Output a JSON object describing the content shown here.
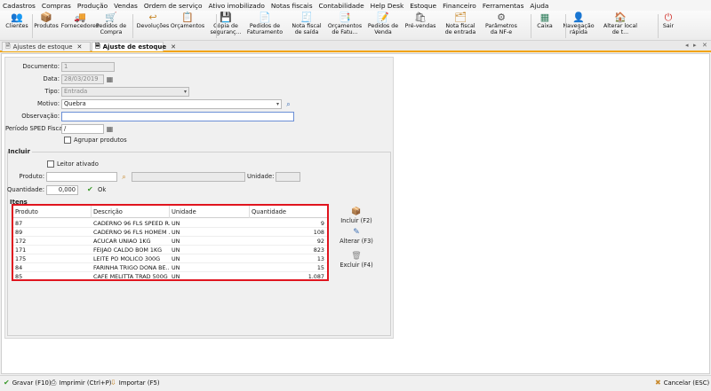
{
  "menu": [
    "Cadastros",
    "Compras",
    "Produção",
    "Vendas",
    "Ordem de serviço",
    "Ativo imobilizado",
    "Notas fiscais",
    "Contabilidade",
    "Help Desk",
    "Estoque",
    "Financeiro",
    "Ferramentas",
    "Ajuda"
  ],
  "toolbar": [
    {
      "name": "clientes",
      "label": [
        "Clientes"
      ],
      "icon": "👥",
      "color": "#3b6db3"
    },
    {
      "name": "produtos",
      "label": [
        "Produtos"
      ],
      "icon": "📦",
      "color": "#c8892c"
    },
    {
      "name": "fornecedores",
      "label": [
        "Fornecedores"
      ],
      "icon": "🚚",
      "color": "#3b6db3"
    },
    {
      "name": "pedidos-compra",
      "label": [
        "Pedidos de",
        "Compra"
      ],
      "icon": "🛒",
      "color": "#555"
    },
    {
      "name": "devolucoes",
      "label": [
        "Devoluções"
      ],
      "icon": "↩",
      "color": "#c8892c"
    },
    {
      "name": "orcamentos",
      "label": [
        "Orçamentos"
      ],
      "icon": "📋",
      "color": "#3b6db3"
    },
    {
      "name": "copia-seguranca",
      "label": [
        "Cópia de",
        "seguranç..."
      ],
      "icon": "💾",
      "color": "#555"
    },
    {
      "name": "pedidos-faturamento",
      "label": [
        "Pedidos de",
        "Faturamento"
      ],
      "icon": "📄",
      "color": "#3b6db3"
    },
    {
      "name": "nota-fiscal-saida",
      "label": [
        "Nota fiscal",
        "de saída"
      ],
      "icon": "🧾",
      "color": "#3b6db3"
    },
    {
      "name": "orcamentos-fatu",
      "label": [
        "Orçamentos",
        "de Fatu..."
      ],
      "icon": "📑",
      "color": "#3b6db3"
    },
    {
      "name": "pedidos-venda",
      "label": [
        "Pedidos de",
        "Venda"
      ],
      "icon": "📝",
      "color": "#c8892c"
    },
    {
      "name": "pre-vendas",
      "label": [
        "Pré-vendas"
      ],
      "icon": "🛍",
      "color": "#555"
    },
    {
      "name": "nota-fiscal-entrada",
      "label": [
        "Nota fiscal",
        "de entrada"
      ],
      "icon": "🗂",
      "color": "#c8892c"
    },
    {
      "name": "parametros-nfe",
      "label": [
        "Parâmetros",
        "da NF-e"
      ],
      "icon": "⚙",
      "color": "#555"
    },
    {
      "name": "caixa",
      "label": [
        "Caixa"
      ],
      "icon": "▦",
      "color": "#2e7d5b"
    },
    {
      "name": "navegacao-rapida",
      "label": [
        "Navegação",
        "rápida"
      ],
      "icon": "👤",
      "color": "#3b6db3"
    },
    {
      "name": "alterar-local",
      "label": [
        "Alterar local",
        "de t..."
      ],
      "icon": "🏠",
      "color": "#c8892c"
    },
    {
      "name": "sair",
      "label": [
        "Sair"
      ],
      "icon": "⏻",
      "color": "#d0302a"
    }
  ],
  "tabs": [
    {
      "label": "Ajustes de estoque",
      "close": "✕",
      "active": false
    },
    {
      "label": "Ajuste de estoque",
      "close": "✕",
      "active": true
    }
  ],
  "tab_nav": {
    "left": "◂",
    "right": "▸",
    "close": "✕"
  },
  "form": {
    "documento_label": "Documento:",
    "documento_value": "1",
    "data_label": "Data:",
    "data_value": "28/03/2019",
    "tipo_label": "Tipo:",
    "tipo_value": "Entrada",
    "motivo_label": "Motivo:",
    "motivo_value": "Quebra",
    "observacao_label": "Observação:",
    "observacao_value": "",
    "periodo_label": "Período SPED Fiscal:",
    "periodo_value": "/",
    "agrupar_label": "Agrupar produtos"
  },
  "incluir": {
    "title": "Incluir",
    "leitor_label": "Leitor ativado",
    "produto_label": "Produto:",
    "produto_value": "",
    "unidade_label": "Unidade:",
    "quantidade_label": "Quantidade:",
    "quantidade_value": "0,000",
    "ok_label": "Ok"
  },
  "itens": {
    "title": "Itens",
    "columns": [
      "Produto",
      "Descrição",
      "Unidade",
      "Quantidade"
    ],
    "rows": [
      [
        "87",
        "CADERNO 96 FLS SPEED R...",
        "UN",
        "9"
      ],
      [
        "89",
        "CADERNO 96 FLS HOMEM ...",
        "UN",
        "108"
      ],
      [
        "172",
        "ACUCAR UNIAO 1KG",
        "UN",
        "92"
      ],
      [
        "171",
        "FEIJAO CALDO BOM 1KG",
        "UN",
        "823"
      ],
      [
        "175",
        "LEITE PO MOLICO 300G",
        "UN",
        "13"
      ],
      [
        "84",
        "FARINHA TRIGO DONA BE...",
        "UN",
        "15"
      ],
      [
        "85",
        "CAFE MELITTA TRAD 500G",
        "UN",
        "1.087"
      ]
    ]
  },
  "side_actions": [
    {
      "name": "incluir-f2",
      "label": "Incluir (F2)",
      "icon": "📦"
    },
    {
      "name": "alterar-f3",
      "label": "Alterar (F3)",
      "icon": "✎"
    },
    {
      "name": "excluir-f4",
      "label": "Excluir (F4)",
      "icon": "🗑"
    }
  ],
  "footer": {
    "gravar": "Gravar (F10)",
    "imprimir": "Imprimir (Ctrl+P)",
    "importar": "Importar (F5)",
    "cancelar": "Cancelar (ESC)"
  },
  "colors": {
    "accent": "#f2a300",
    "highlight": "#e0141e",
    "ok": "#3a9a2a"
  }
}
